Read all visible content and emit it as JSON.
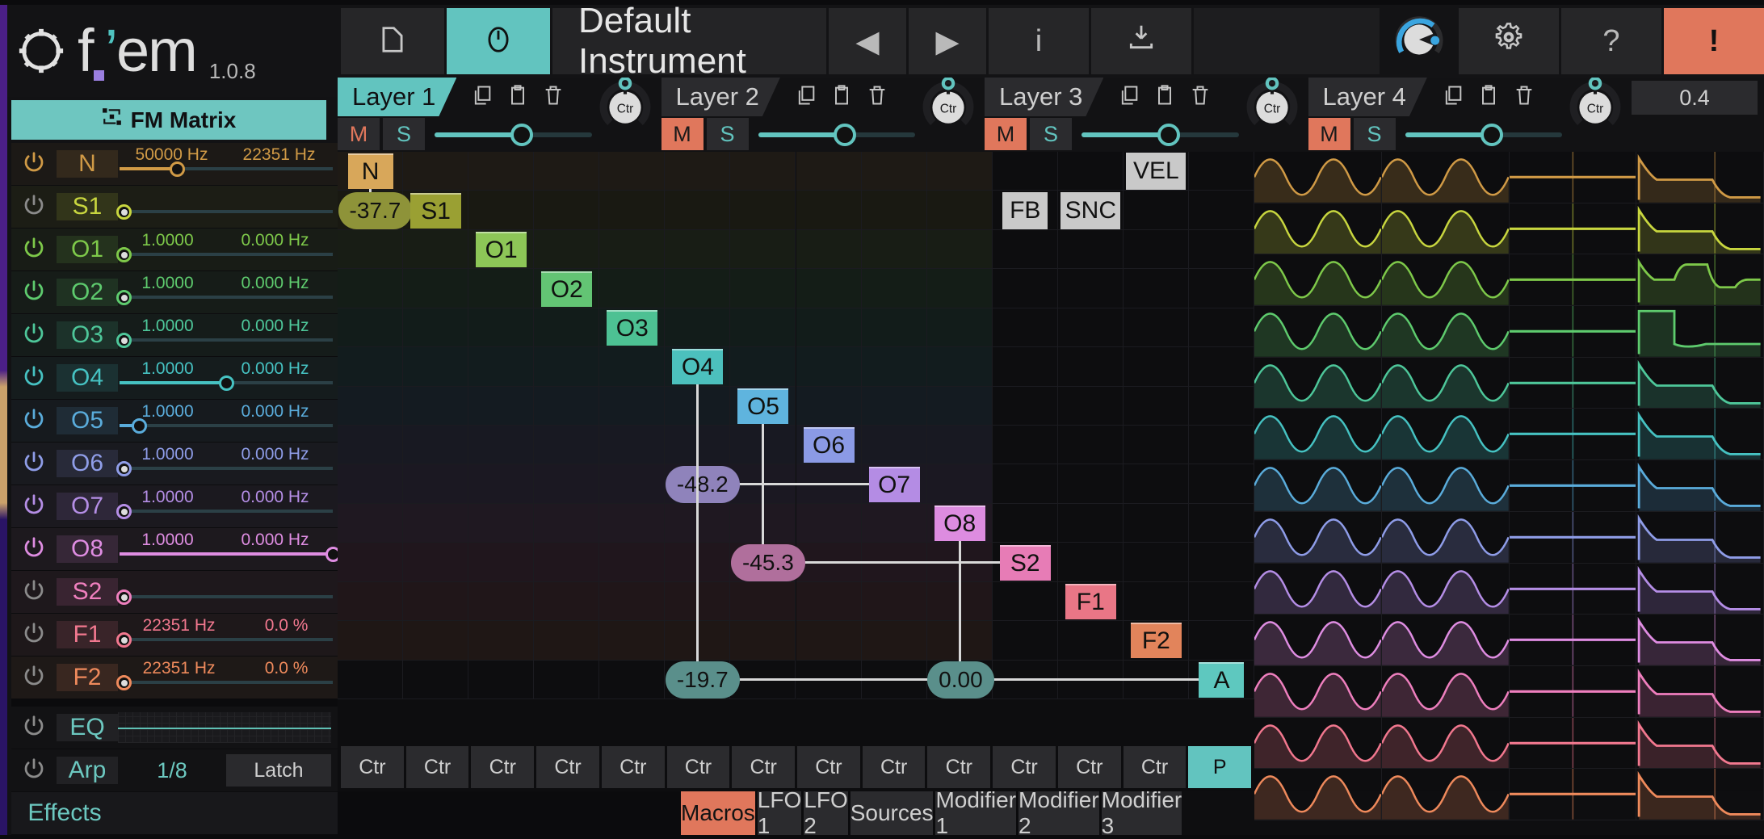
{
  "brand": {
    "name_f": "f",
    "name_em": "em",
    "version": "1.0.8",
    "apostrophe": "’"
  },
  "sidebar": {
    "header": {
      "label": "FM Matrix",
      "icon": "fm-matrix-icon"
    },
    "rows": [
      {
        "name": "N",
        "color": "#d09a46",
        "on": true,
        "v1": "50000 Hz",
        "v2": "22351 Hz",
        "slider": 27,
        "knob": "solid"
      },
      {
        "name": "S1",
        "color": "#c8d63f",
        "on": false,
        "v1": "",
        "v2": "",
        "slider": 2,
        "knob": "dotted"
      },
      {
        "name": "O1",
        "color": "#7ec94a",
        "on": true,
        "v1": "1.0000",
        "v2": "0.000 Hz",
        "slider": 2,
        "knob": "dotted"
      },
      {
        "name": "O2",
        "color": "#5ecb6e",
        "on": true,
        "v1": "1.0000",
        "v2": "0.000 Hz",
        "slider": 2,
        "knob": "dotted"
      },
      {
        "name": "O3",
        "color": "#4ec79a",
        "on": true,
        "v1": "1.0000",
        "v2": "0.000 Hz",
        "slider": 2,
        "knob": "dotted"
      },
      {
        "name": "O4",
        "color": "#46c2c2",
        "on": true,
        "v1": "1.0000",
        "v2": "0.000 Hz",
        "slider": 50,
        "knob": "solid"
      },
      {
        "name": "O5",
        "color": "#5aacdb",
        "on": true,
        "v1": "1.0000",
        "v2": "0.000 Hz",
        "slider": 9,
        "knob": "solid"
      },
      {
        "name": "O6",
        "color": "#8f9de8",
        "on": true,
        "v1": "1.0000",
        "v2": "0.000 Hz",
        "slider": 2,
        "knob": "dotted"
      },
      {
        "name": "O7",
        "color": "#b58ee6",
        "on": true,
        "v1": "1.0000",
        "v2": "0.000 Hz",
        "slider": 2,
        "knob": "dotted"
      },
      {
        "name": "O8",
        "color": "#df8de2",
        "on": true,
        "v1": "1.0000",
        "v2": "0.000 Hz",
        "slider": 100,
        "knob": "solid"
      },
      {
        "name": "S2",
        "color": "#ef7fbe",
        "on": false,
        "v1": "",
        "v2": "",
        "slider": 2,
        "knob": "dotted"
      },
      {
        "name": "F1",
        "color": "#f2788f",
        "on": false,
        "v1": "22351 Hz",
        "v2": "0.0 %",
        "slider": 2,
        "knob": "dotted"
      },
      {
        "name": "F2",
        "color": "#ef8a5c",
        "on": false,
        "v1": "22351 Hz",
        "v2": "0.0 %",
        "slider": 2,
        "knob": "dotted"
      }
    ],
    "eq": {
      "name": "EQ",
      "on": false
    },
    "arp": {
      "name": "Arp",
      "on": false,
      "rate": "1/8",
      "latch": "Latch"
    },
    "effects": {
      "name": "Effects",
      "on": false
    }
  },
  "toolbar": {
    "file_icon": "file-icon",
    "preset_icon": "preset-clock-icon",
    "instrument_name": "Default Instrument",
    "prev_label": "◀",
    "next_label": "▶",
    "info_label": "i",
    "import_icon": "import-icon",
    "volume_knob": "volume-knob",
    "settings_icon": "gear-icon",
    "help_label": "?",
    "panic_label": "!",
    "accent": "#62c4bf",
    "panic_color": "#e0775c"
  },
  "layers": {
    "value_box": "0.4",
    "items": [
      {
        "label": "Layer 1",
        "active": true,
        "mute": "M",
        "solo": "S",
        "muted": false,
        "level": 55,
        "ctr": "Ctr"
      },
      {
        "label": "Layer 2",
        "active": false,
        "mute": "M",
        "solo": "S",
        "muted": true,
        "level": 55,
        "ctr": "Ctr"
      },
      {
        "label": "Layer 3",
        "active": false,
        "mute": "M",
        "solo": "S",
        "muted": true,
        "level": 55,
        "ctr": "Ctr"
      },
      {
        "label": "Layer 4",
        "active": false,
        "mute": "M",
        "solo": "S",
        "muted": true,
        "level": 55,
        "ctr": "Ctr"
      }
    ],
    "copy_icon": "copy-icon",
    "paste_icon": "paste-icon",
    "delete_icon": "trash-icon"
  },
  "matrix": {
    "nodes": [
      {
        "label": "N",
        "col": 0,
        "row": 0,
        "color": "#d8a75a"
      },
      {
        "label": "S1",
        "col": 1,
        "row": 1,
        "color": "#9aa033"
      },
      {
        "label": "O1",
        "col": 2,
        "row": 2,
        "color": "#8dc657"
      },
      {
        "label": "O2",
        "col": 3,
        "row": 3,
        "color": "#63c474"
      },
      {
        "label": "O3",
        "col": 4,
        "row": 4,
        "color": "#4dc193"
      },
      {
        "label": "O4",
        "col": 5,
        "row": 5,
        "color": "#4cc0bd"
      },
      {
        "label": "O5",
        "col": 6,
        "row": 6,
        "color": "#5fb4de"
      },
      {
        "label": "O6",
        "col": 7,
        "row": 7,
        "color": "#8b9ae5"
      },
      {
        "label": "O7",
        "col": 8,
        "row": 8,
        "color": "#b48ce4"
      },
      {
        "label": "O8",
        "col": 9,
        "row": 9,
        "color": "#dd8ce0"
      },
      {
        "label": "S2",
        "col": 10,
        "row": 10,
        "color": "#e77cb6"
      },
      {
        "label": "F1",
        "col": 11,
        "row": 11,
        "color": "#e97686"
      },
      {
        "label": "F2",
        "col": 12,
        "row": 12,
        "color": "#e2845b"
      },
      {
        "label": "A",
        "col": 13,
        "row": 13,
        "color": "#5ec8bf"
      }
    ],
    "connections": [
      {
        "value": "-37.7",
        "from": "N",
        "to": "S1",
        "col": 0,
        "row": 1,
        "color": "#8e9339"
      },
      {
        "value": "-48.2",
        "from": "O4",
        "to": "O7",
        "col": 5,
        "row": 8,
        "color": "#8f83bb"
      },
      {
        "value": "-45.3",
        "from": "O5",
        "to": "S2",
        "col": 6,
        "row": 10,
        "color": "#b06f9c"
      },
      {
        "value": "-19.7",
        "from": "O4",
        "to": "A",
        "col": 5,
        "row": 13,
        "color": "#5a8f8b"
      },
      {
        "value": "0.00",
        "from": "O8",
        "to": "A",
        "col": 9,
        "row": 13,
        "color": "#5a8f8b"
      }
    ],
    "toggles": [
      {
        "label": "VEL",
        "col": 12,
        "row": 0
      },
      {
        "label": "FB",
        "col": 10,
        "row": 1
      },
      {
        "label": "SNC",
        "col": 11,
        "row": 1
      }
    ],
    "ctr_buttons": [
      "Ctr",
      "Ctr",
      "Ctr",
      "Ctr",
      "Ctr",
      "Ctr",
      "Ctr",
      "Ctr",
      "Ctr",
      "Ctr",
      "Ctr",
      "Ctr",
      "Ctr"
    ],
    "preset_button": "P"
  },
  "waves": {
    "rows": [
      {
        "color": "#d09a46",
        "env": "pluck"
      },
      {
        "color": "#c8d63f",
        "env": "pluck"
      },
      {
        "color": "#7ec94a",
        "env": "multi"
      },
      {
        "color": "#5ecb6e",
        "env": "gate"
      },
      {
        "color": "#4ec79a",
        "env": "pluck"
      },
      {
        "color": "#46c2c2",
        "env": "pluck"
      },
      {
        "color": "#5aacdb",
        "env": "pluck"
      },
      {
        "color": "#8f9de8",
        "env": "pluck"
      },
      {
        "color": "#b58ee6",
        "env": "pluck"
      },
      {
        "color": "#df8de2",
        "env": "pluck"
      },
      {
        "color": "#ef7fbe",
        "env": "pluck"
      },
      {
        "color": "#f2788f",
        "env": "pluck"
      },
      {
        "color": "#ef8a5c",
        "env": "pluck"
      }
    ]
  },
  "bottom_tabs": [
    {
      "label": "Macros",
      "active": true
    },
    {
      "label": "LFO 1",
      "active": false
    },
    {
      "label": "LFO 2",
      "active": false
    },
    {
      "label": "Sources",
      "active": false
    },
    {
      "label": "Modifier 1",
      "active": false
    },
    {
      "label": "Modifier 2",
      "active": false
    },
    {
      "label": "Modifier 3",
      "active": false
    }
  ]
}
